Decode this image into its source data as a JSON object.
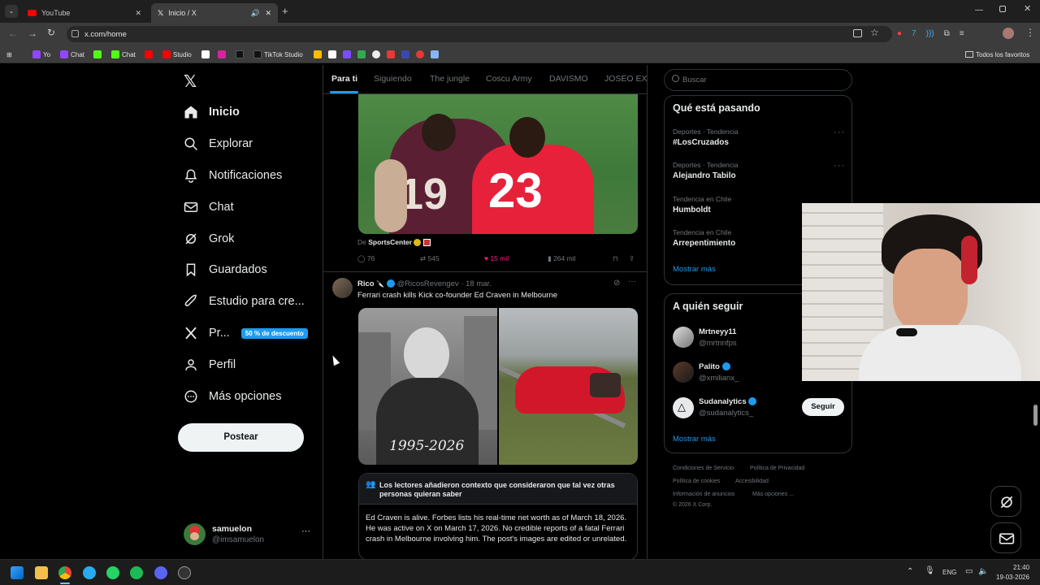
{
  "browser": {
    "tabs": [
      {
        "title": "YouTube",
        "active": false
      },
      {
        "title": "Inicio / X",
        "active": true
      }
    ],
    "url": "x.com/home",
    "bookmarks": [
      "Yo",
      "Chat",
      "Chat",
      "Studio",
      "TikTok Studio"
    ],
    "all_bookmarks": "Todos los favoritos"
  },
  "nav": {
    "items": [
      {
        "label": "Inicio",
        "icon": "home-icon"
      },
      {
        "label": "Explorar",
        "icon": "search-icon"
      },
      {
        "label": "Notificaciones",
        "icon": "bell-icon"
      },
      {
        "label": "Chat",
        "icon": "mail-icon"
      },
      {
        "label": "Grok",
        "icon": "grok-icon"
      },
      {
        "label": "Guardados",
        "icon": "bookmark-icon"
      },
      {
        "label": "Estudio para cre...",
        "icon": "rocket-icon"
      },
      {
        "label": "Pr...",
        "icon": "x-icon"
      },
      {
        "label": "Perfil",
        "icon": "person-icon"
      },
      {
        "label": "Más opciones",
        "icon": "more-circle-icon"
      }
    ],
    "premium_badge": "50 % de descuento",
    "post_button": "Postear",
    "account": {
      "name": "samuelon",
      "handle": "@imsamuelon"
    }
  },
  "feed_tabs": [
    "Para ti",
    "Siguiendo",
    "The jungle",
    "Coscu Army",
    "DAVISMO",
    "JOSEO EXC"
  ],
  "post1": {
    "source_prefix": "De",
    "source": "SportsCenter",
    "replies": "76",
    "reposts": "545",
    "likes": "15 mil",
    "views": "264 mil"
  },
  "post2": {
    "name": "Rico",
    "handle": "@RicosRevengev",
    "time": "· 18 mar.",
    "text": "Ferrari crash kills Kick co-founder Ed Craven in Melbourne",
    "image_caption": "1995-2026",
    "note_header": "Los lectores añadieron contexto que consideraron que tal vez otras personas quieran saber",
    "note_text": "Ed Craven is alive. Forbes lists his real-time net worth as of March 18, 2026. He was active on X on March 17, 2026. No credible reports of a fatal Ferrari crash in Melbourne involving him. The post's images are edited or unrelated."
  },
  "sidebar": {
    "search_placeholder": "Buscar",
    "trends_title": "Qué está pasando",
    "trends": [
      {
        "context": "Deportes · Tendencia",
        "title": "#LosCruzados"
      },
      {
        "context": "Deportes · Tendencia",
        "title": "Alejandro Tabilo"
      },
      {
        "context": "Tendencia en Chile",
        "title": "Humboldt"
      },
      {
        "context": "Tendencia en Chile",
        "title": "Arrepentimiento"
      }
    ],
    "show_more": "Mostrar más",
    "who_to_follow_title": "A quién seguir",
    "follow": [
      {
        "name": "Mrtneyy11",
        "handle": "@mrtnnfps"
      },
      {
        "name": "Palito",
        "handle": "@xmilianx_"
      },
      {
        "name": "Sudanalytics",
        "handle": "@sudanalytics_"
      }
    ],
    "follow_button": "Seguir",
    "show_more2": "Mostrar más",
    "footer": [
      "Condiciones de Servicio",
      "Política de Privacidad",
      "Política de cookies",
      "Accesibilidad",
      "Información de anuncios",
      "Más opciones ...",
      "© 2026 X Corp."
    ]
  },
  "jersey_numbers": [
    "19",
    "23"
  ],
  "taskbar": {
    "lang": "ENG",
    "time": "21:40",
    "date": "19-03-2026"
  },
  "colors": {
    "accent": "#1d9bf0",
    "like": "#f91880",
    "background": "#000000"
  }
}
